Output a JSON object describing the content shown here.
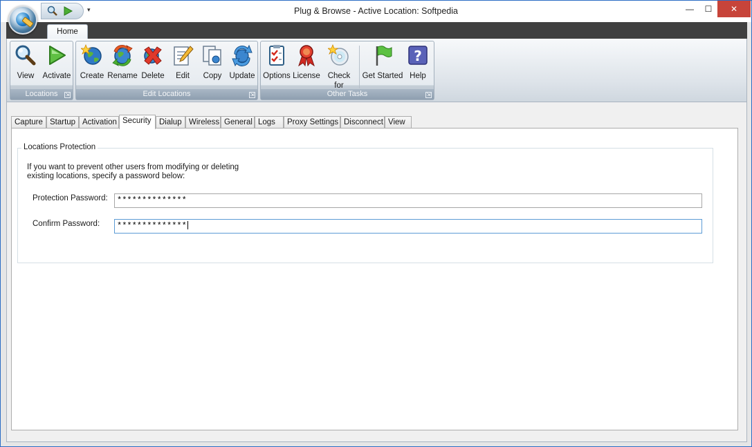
{
  "window": {
    "title": "Plug & Browse - Active Location: Softpedia",
    "controls": {
      "minimize": "—",
      "maximize": "☐",
      "close": "✕"
    }
  },
  "quick_access": {
    "dropdown": "▾"
  },
  "ribbon": {
    "tab": "Home",
    "groups": [
      {
        "label": "Locations",
        "buttons": [
          "View",
          "Activate"
        ]
      },
      {
        "label": "Edit Locations",
        "buttons": [
          "Create",
          "Rename",
          "Delete",
          "Edit",
          "Copy",
          "Update"
        ]
      },
      {
        "label": "Other Tasks",
        "buttons": [
          "Options",
          "License",
          "Check for Updates",
          "Get Started",
          "Help"
        ]
      }
    ],
    "launcher_glyph": "⇲"
  },
  "tabs": [
    "Capture",
    "Startup",
    "Activation",
    "Security",
    "Dialup",
    "Wireless",
    "General",
    "Logs",
    "Proxy Settings",
    "Disconnect",
    "View"
  ],
  "active_tab": "Security",
  "security": {
    "group_title": "Locations Protection",
    "info_line1": "If you want to prevent other users from modifying or deleting",
    "info_line2": "existing locations, specify a password below:",
    "protection_label": "Protection Password:",
    "protection_value": "**************",
    "confirm_label": "Confirm Password:",
    "confirm_value": "**************"
  },
  "colors": {
    "close_button": "#c7443a",
    "ribbon_group_label": "#8e9fb0",
    "focus_border": "#5b9bd5"
  }
}
